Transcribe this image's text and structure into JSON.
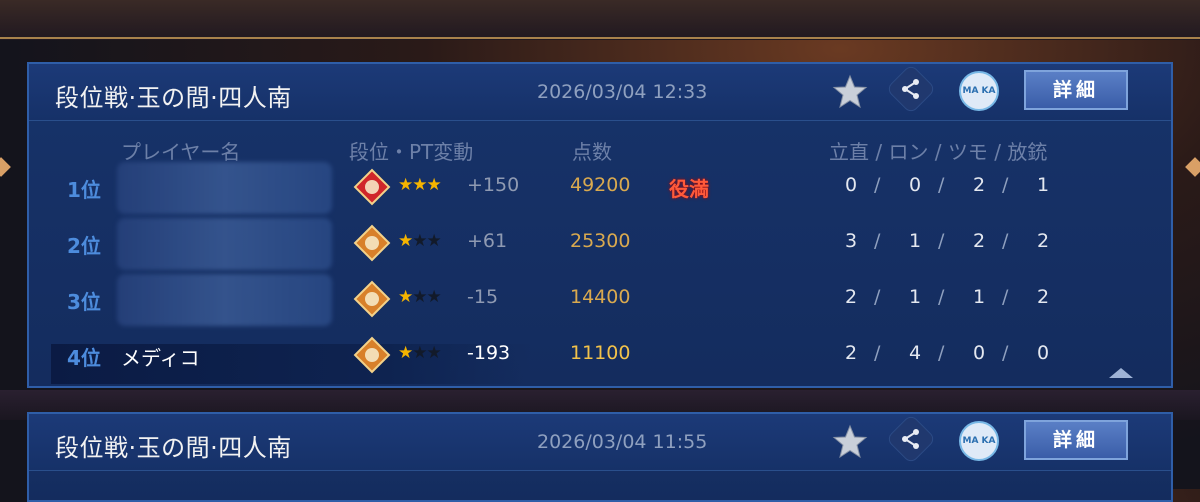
{
  "cards": [
    {
      "title": "段位戦·玉の間·四人南",
      "datetime": "2026/03/04 12:33",
      "detail_label": "詳細",
      "maka_label": "MA KA",
      "columns": {
        "player": "プレイヤー名",
        "rank_pt": "段位・PT変動",
        "score": "点数",
        "stats": "立直 / ロン / ツモ / 放銃"
      },
      "rows": [
        {
          "rank": "1位",
          "name": "",
          "stars": 3,
          "pt": "+150",
          "score": "49200",
          "note": "役満",
          "riichi": "0",
          "ron": "0",
          "tsumo": "2",
          "deal_in": "1",
          "badge_color": "#d0262a"
        },
        {
          "rank": "2位",
          "name": "",
          "stars": 1,
          "pt": "+61",
          "score": "25300",
          "note": "",
          "riichi": "3",
          "ron": "1",
          "tsumo": "2",
          "deal_in": "2",
          "badge_color": "#d8802a"
        },
        {
          "rank": "3位",
          "name": "",
          "stars": 1,
          "pt": "-15",
          "score": "14400",
          "note": "",
          "riichi": "2",
          "ron": "1",
          "tsumo": "1",
          "deal_in": "2",
          "badge_color": "#d8802a"
        },
        {
          "rank": "4位",
          "name": "メディコ",
          "stars": 1,
          "pt": "-193",
          "score": "11100",
          "note": "",
          "riichi": "2",
          "ron": "4",
          "tsumo": "0",
          "deal_in": "0",
          "badge_color": "#d8802a"
        }
      ]
    },
    {
      "title": "段位戦·玉の間·四人南",
      "datetime": "2026/03/04 11:55",
      "detail_label": "詳細",
      "maka_label": "MA KA"
    }
  ],
  "icons": [
    "star-icon",
    "share-icon",
    "maka-icon",
    "collapse-icon"
  ],
  "colors": {
    "accent": "#2f5ea8",
    "score": "#d9a94f",
    "rank": "#4d8cdd",
    "yakuman": "#ff5a3a",
    "star": "#f5b400"
  }
}
